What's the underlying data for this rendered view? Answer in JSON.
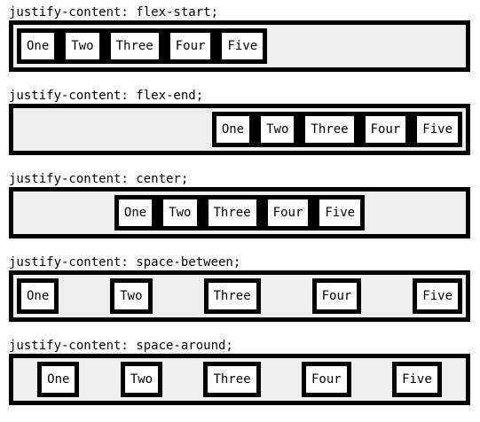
{
  "items": [
    "One",
    "Two",
    "Three",
    "Four",
    "Five"
  ],
  "rows": [
    {
      "caption": "justify-content: flex-start;"
    },
    {
      "caption": "justify-content: flex-end;"
    },
    {
      "caption": "justify-content: center;"
    },
    {
      "caption": "justify-content: space-between;"
    },
    {
      "caption": "justify-content: space-around;"
    }
  ]
}
